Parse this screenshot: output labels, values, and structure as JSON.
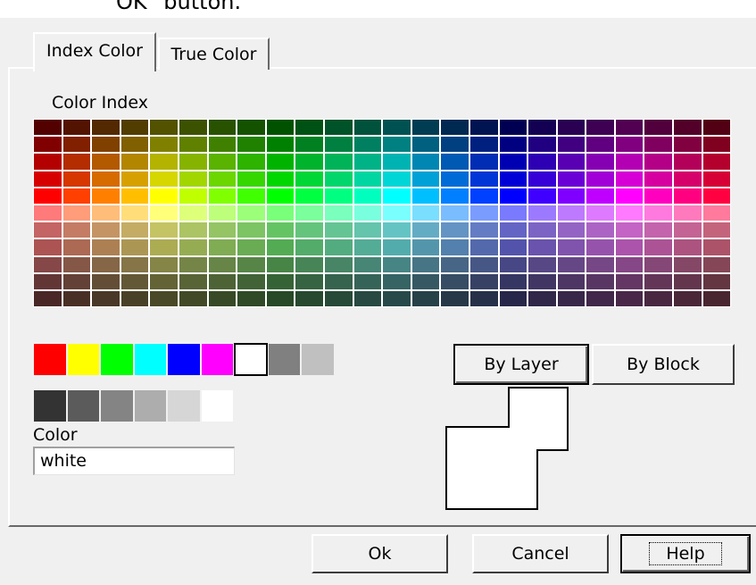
{
  "top_text": "OK\" button.",
  "tabs": {
    "index_color": "Index Color",
    "true_color": "True Color"
  },
  "labels": {
    "color_index": "Color Index",
    "color": "Color"
  },
  "color_field": {
    "value": "white"
  },
  "buttons": {
    "by_layer": "By Layer",
    "by_block": "By Block",
    "ok": "Ok",
    "cancel": "Cancel",
    "help": "Help"
  },
  "standard_colors": [
    "#ff0000",
    "#ffff00",
    "#00ff00",
    "#00ffff",
    "#0000ff",
    "#ff00ff",
    "#ffffff",
    "#808080",
    "#c0c0c0"
  ],
  "selected_standard": "#ffffff",
  "gray_colors": [
    "#333333",
    "#5b5b5b",
    "#848484",
    "#adadad",
    "#d6d6d6",
    "#ffffff"
  ],
  "palette": {
    "columns": 24,
    "hues": [
      0,
      15,
      30,
      45,
      60,
      75,
      90,
      105,
      120,
      135,
      150,
      165,
      180,
      195,
      210,
      225,
      240,
      255,
      270,
      285,
      300,
      315,
      330,
      345
    ],
    "rows": [
      {
        "s": 100,
        "l": 16
      },
      {
        "s": 100,
        "l": 25
      },
      {
        "s": 100,
        "l": 35
      },
      {
        "s": 100,
        "l": 42
      },
      {
        "s": 100,
        "l": 50
      },
      {
        "s": 100,
        "l": 74
      },
      {
        "s": 45,
        "l": 58
      },
      {
        "s": 35,
        "l": 50
      },
      {
        "s": 30,
        "l": 40
      },
      {
        "s": 30,
        "l": 30
      },
      {
        "s": 30,
        "l": 22
      }
    ]
  }
}
